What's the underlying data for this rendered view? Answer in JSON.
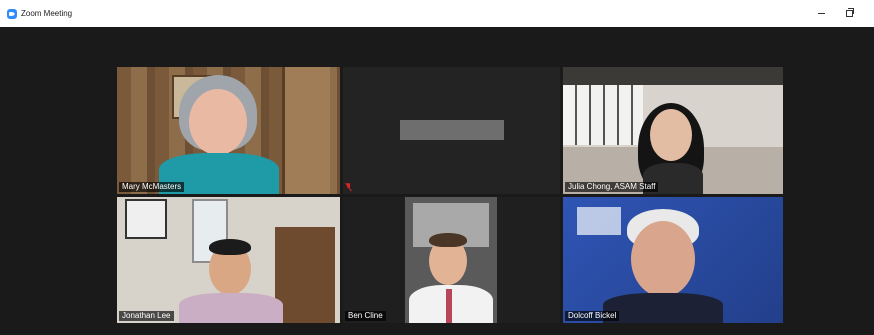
{
  "window": {
    "title": "Zoom Meeting",
    "minimize_icon": "minimize-icon",
    "restore_icon": "restore-icon",
    "app_icon": "zoom-camera-icon"
  },
  "participants": [
    {
      "name": "Mary McMasters",
      "active_speaker": true,
      "video_on": true
    },
    {
      "name": "",
      "active_speaker": false,
      "video_on": false,
      "muted": true
    },
    {
      "name": "Julia Chong, ASAM Staff",
      "active_speaker": false,
      "video_on": true
    },
    {
      "name": "Jonathan Lee",
      "active_speaker": false,
      "video_on": true
    },
    {
      "name": "Ben Cline",
      "active_speaker": false,
      "video_on": true
    },
    {
      "name": "Dolcoff Bickel",
      "active_speaker": false,
      "video_on": true
    }
  ],
  "colors": {
    "active_border": "#b6e61a",
    "background": "#1a1a1a",
    "muted": "#e02424"
  }
}
